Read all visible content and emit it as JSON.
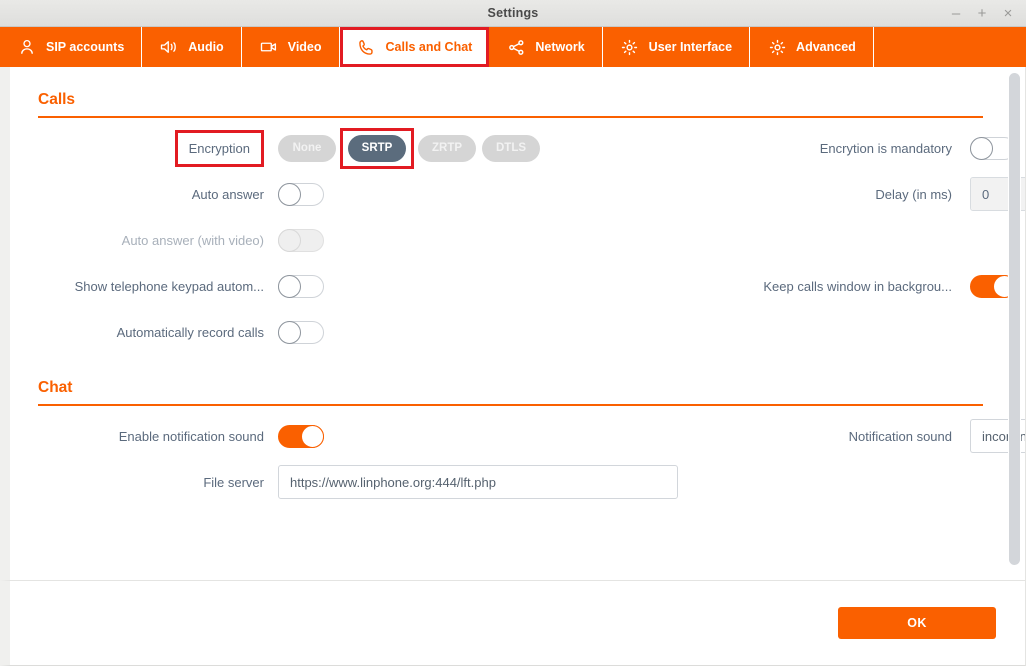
{
  "window": {
    "title": "Settings",
    "controls": [
      {
        "name": "minimize",
        "glyph": "–"
      },
      {
        "name": "maximize",
        "glyph": "+"
      },
      {
        "name": "close",
        "glyph": "×"
      }
    ]
  },
  "accent_color": "#fa6000",
  "highlight_color": "#e21b22",
  "selected_segment_color": "#5b6c7d",
  "tabs": [
    {
      "label": "SIP accounts",
      "icon": "user-icon",
      "active": false,
      "highlighted": false
    },
    {
      "label": "Audio",
      "icon": "speaker-icon",
      "active": false,
      "highlighted": false
    },
    {
      "label": "Video",
      "icon": "camera-icon",
      "active": false,
      "highlighted": false
    },
    {
      "label": "Calls and Chat",
      "icon": "phone-icon",
      "active": true,
      "highlighted": true
    },
    {
      "label": "Network",
      "icon": "share-icon",
      "active": false,
      "highlighted": false
    },
    {
      "label": "User Interface",
      "icon": "gear-icon",
      "active": false,
      "highlighted": false
    },
    {
      "label": "Advanced",
      "icon": "gear-icon",
      "active": false,
      "highlighted": false
    }
  ],
  "calls": {
    "section_title": "Calls",
    "encryption": {
      "label": "Encryption",
      "label_highlighted": true,
      "options": [
        {
          "label": "None",
          "selected": false,
          "highlighted": false
        },
        {
          "label": "SRTP",
          "selected": true,
          "highlighted": true
        },
        {
          "label": "ZRTP",
          "selected": false,
          "highlighted": false
        },
        {
          "label": "DTLS",
          "selected": false,
          "highlighted": false
        }
      ]
    },
    "encryption_mandatory": {
      "label": "Encrytion is mandatory",
      "value": "off"
    },
    "auto_answer": {
      "label": "Auto answer",
      "value": "off"
    },
    "delay": {
      "label": "Delay (in ms)",
      "value": "0",
      "increment": "+",
      "decrement": "-"
    },
    "auto_answer_video": {
      "label": "Auto answer (with video)",
      "value": "off",
      "disabled": true
    },
    "keypad_auto": {
      "label": "Show telephone keypad autom...",
      "value": "off"
    },
    "keep_window_background": {
      "label": "Keep calls window in backgrou...",
      "value": "on"
    },
    "auto_record": {
      "label": "Automatically record calls",
      "value": "off"
    }
  },
  "chat": {
    "section_title": "Chat",
    "enable_notification_sound": {
      "label": "Enable notification sound",
      "value": "on"
    },
    "notification_sound": {
      "label": "Notification sound",
      "value": "incoming_chat.wav",
      "placeholder": "incoming_chat.wav",
      "browse_icon": "document-browse-icon"
    },
    "file_server": {
      "label": "File server",
      "value": "https://www.linphone.org:444/lft.php",
      "placeholder": "https://www.linphone.org:444/lft.php"
    }
  },
  "footer": {
    "ok_label": "OK"
  },
  "scrollbar": {
    "name": "vertical-scrollbar"
  }
}
